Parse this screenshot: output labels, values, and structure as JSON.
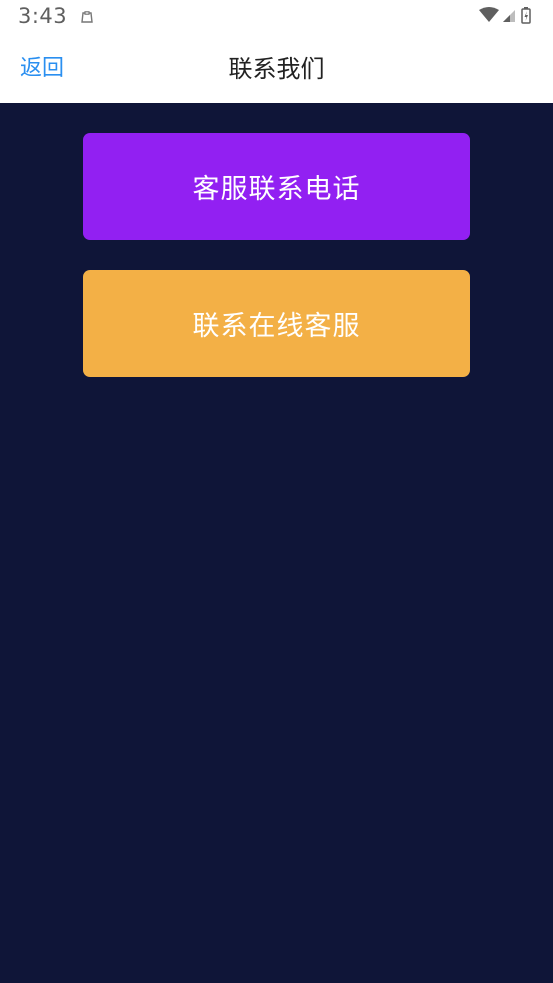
{
  "status_bar": {
    "time": "3:43",
    "notification_icon": "clipboard-icon",
    "wifi_icon": "wifi-icon",
    "signal_icon": "signal-icon",
    "battery_icon": "battery-icon"
  },
  "nav": {
    "back_label": "返回",
    "title": "联系我们"
  },
  "actions": {
    "phone_label": "客服联系电话",
    "online_label": "联系在线客服"
  },
  "colors": {
    "background": "#0f1538",
    "back_link": "#2a8ff0",
    "phone_button": "#9220f2",
    "online_button": "#f3b046"
  }
}
